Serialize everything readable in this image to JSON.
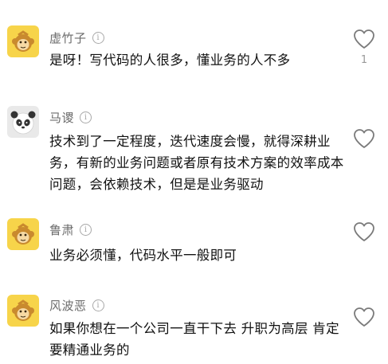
{
  "comments": [
    {
      "username": "虚竹子",
      "avatar_icon": "monkey-avatar-icon",
      "text": "是呀！写代码的人很多，懂业务的人不多",
      "likes": "1"
    },
    {
      "username": "马谡",
      "avatar_icon": "panda-avatar-icon",
      "text": "技术到了一定程度，迭代速度会慢，就得深耕业务，有新的业务问题或者原有技术方案的效率成本问题，会依赖技术，但是是业务驱动",
      "likes": ""
    },
    {
      "username": "鲁肃",
      "avatar_icon": "monkey-avatar-icon",
      "text": "业务必须懂，代码水平一般即可",
      "likes": ""
    },
    {
      "username": "风波恶",
      "avatar_icon": "monkey-avatar-icon",
      "text": "如果你想在一个公司一直干下去  升职为高层  肯定要精通业务的",
      "likes": ""
    }
  ],
  "info_glyph": "i",
  "colors": {
    "avatar_yellow": "#f7d44a",
    "monkey_brown": "#c98a2e",
    "heart_stroke": "#7a7a7a"
  }
}
